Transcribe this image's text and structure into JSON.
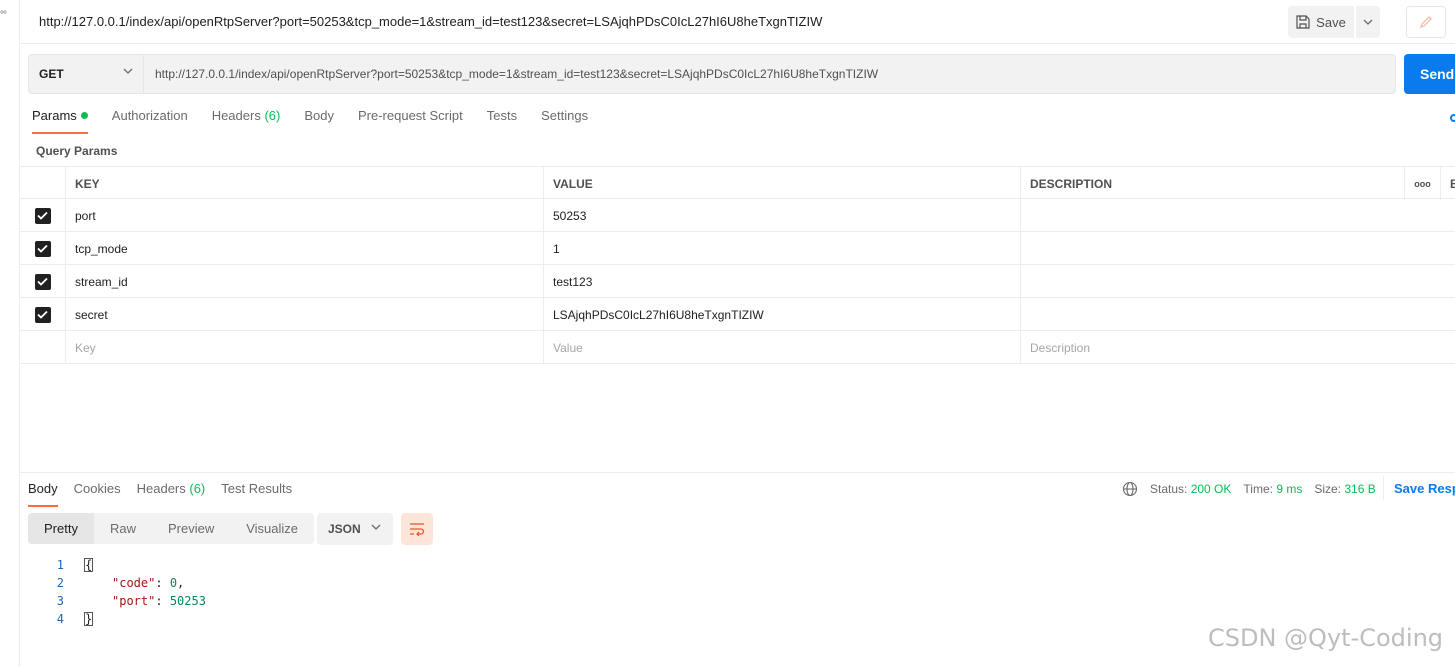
{
  "header": {
    "title": "http://127.0.0.1/index/api/openRtpServer?port=50253&tcp_mode=1&stream_id=test123&secret=LSAjqhPDsC0IcL27hI6U8heTxgnTIZIW",
    "save_label": "Save"
  },
  "request": {
    "method": "GET",
    "url": "http://127.0.0.1/index/api/openRtpServer?port=50253&tcp_mode=1&stream_id=test123&secret=LSAjqhPDsC0IcL27hI6U8heTxgnTIZIW",
    "send_label": "Send"
  },
  "request_tabs": {
    "params": "Params",
    "authorization": "Authorization",
    "headers": "Headers",
    "headers_count": "(6)",
    "body": "Body",
    "prerequest": "Pre-request Script",
    "tests": "Tests",
    "settings": "Settings"
  },
  "query_params": {
    "label": "Query Params",
    "columns": {
      "key": "KEY",
      "value": "VALUE",
      "description": "DESCRIPTION",
      "more": "ooo",
      "bulk": "B"
    },
    "rows": [
      {
        "key": "port",
        "value": "50253",
        "description": ""
      },
      {
        "key": "tcp_mode",
        "value": "1",
        "description": ""
      },
      {
        "key": "stream_id",
        "value": "test123",
        "description": ""
      },
      {
        "key": "secret",
        "value": "LSAjqhPDsC0IcL27hI6U8heTxgnTIZIW",
        "description": ""
      }
    ],
    "placeholders": {
      "key": "Key",
      "value": "Value",
      "description": "Description"
    }
  },
  "response_tabs": {
    "body": "Body",
    "cookies": "Cookies",
    "headers": "Headers",
    "headers_count": "(6)",
    "test_results": "Test Results"
  },
  "response_status": {
    "status_label": "Status:",
    "status_value": "200 OK",
    "time_label": "Time:",
    "time_value": "9 ms",
    "size_label": "Size:",
    "size_value": "316 B",
    "save_response": "Save Respo"
  },
  "view_modes": [
    "Pretty",
    "Raw",
    "Preview",
    "Visualize"
  ],
  "format": "JSON",
  "response_body": {
    "line1": "1",
    "line2": "2",
    "line3": "3",
    "line4": "4",
    "open_brace": "{",
    "code_key": "\"code\"",
    "code_value": "0",
    "port_key": "\"port\"",
    "port_value": "50253",
    "close_brace": "}"
  },
  "watermark": "CSDN @Qyt-Coding",
  "colors": {
    "accent": "#ff6c37",
    "send_blue": "#097bed",
    "status_green": "#0cbb52"
  }
}
